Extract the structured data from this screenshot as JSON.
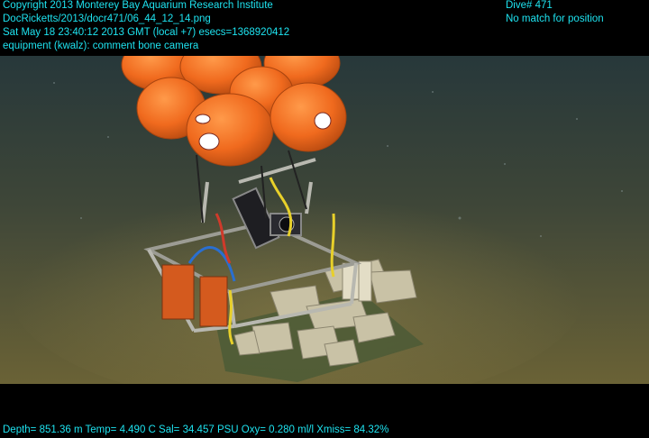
{
  "overlay": {
    "top_left_lines": [
      "Copyright 2013 Monterey Bay Aquarium Research Institute",
      "DocRicketts/2013/docr471/06_44_12_14.png",
      "Sat May 18 23:40:12 2013 GMT (local +7)  esecs=1368920412",
      "equipment (kwalz): comment bone camera"
    ],
    "top_right_lines": [
      "Dive# 471",
      "No match for position"
    ],
    "bottom_line": "Depth= 851.36 m  Temp= 4.490 C  Sal= 34.457 PSU  Oxy= 0.280 ml/l  Xmiss= 84.32%"
  },
  "colors": {
    "overlay_text": "#1ee3f0",
    "seafloor": "#5a5630",
    "water": "#2a3a3a",
    "floats": "#f06a1e",
    "frame_metal": "#b8b8b0",
    "bones": "#c9c2a6"
  }
}
